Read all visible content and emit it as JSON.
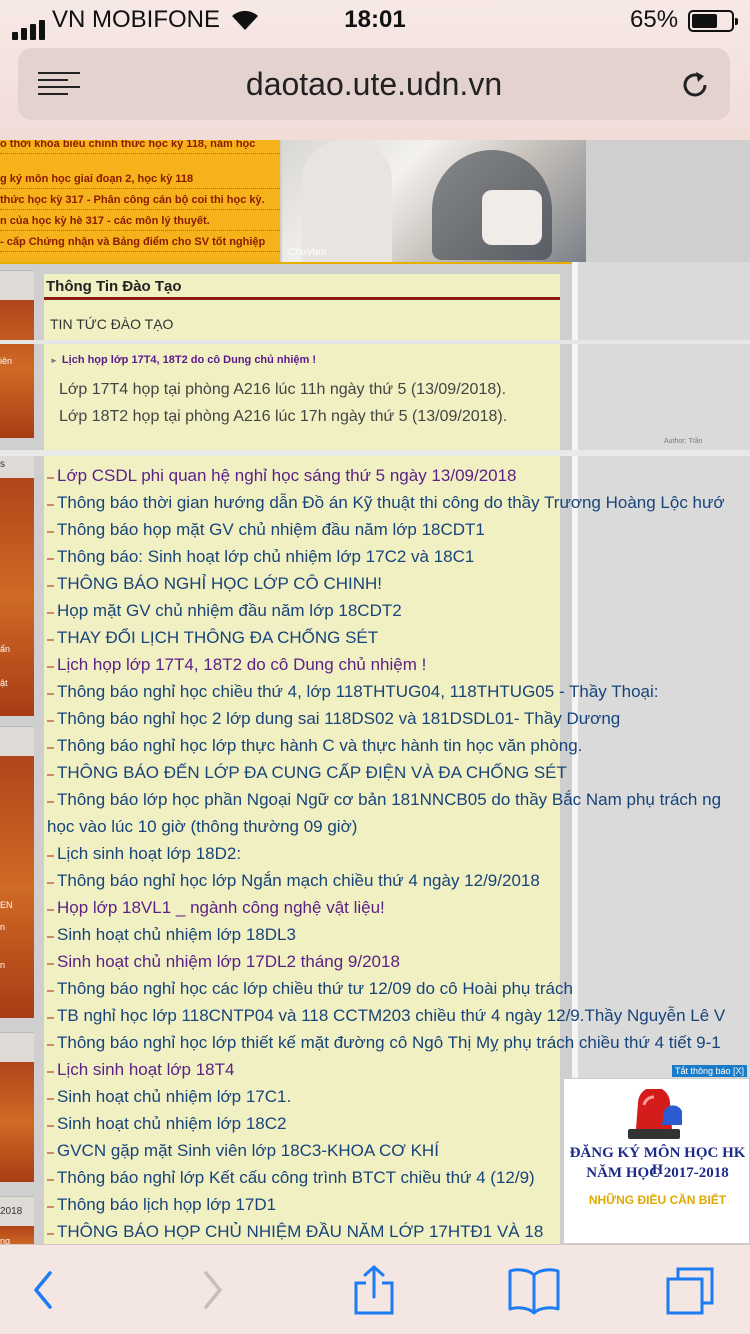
{
  "status_bar": {
    "carrier": "VN MOBIFONE",
    "time": "18:01",
    "battery": "65%",
    "battery_level": 0.65
  },
  "browser": {
    "url": "daotao.ute.udn.vn"
  },
  "banner": {
    "news_lines": [
      "o thời khóa biểu chính thức học kỳ 118, năm học",
      "g ký môn học giai đoạn 2, học kỳ 118",
      "thức học kỳ 317 - Phân công cán bộ coi thi học kỳ.",
      "n của học kỳ hè 317 - các môn lý thuyết.",
      "- cấp Chứng nhận và Bảng điểm cho SV tốt nghiệp"
    ],
    "photo_watermark": "ChoVam"
  },
  "sidebar": {
    "fragments": [
      "iên",
      "s",
      "ẩn",
      "ật",
      "EN",
      "n",
      "n",
      "2018",
      "ng"
    ]
  },
  "section": {
    "title": "Thông Tin Đào Tạo",
    "subtitle": "TIN TỨC ĐÀO TẠO"
  },
  "featured": {
    "link": "Lịch họp lớp 17T4, 18T2 do cô Dung chủ nhiệm !",
    "lines": [
      "Lớp 17T4 họp tại phòng A216 lúc 11h ngày thứ 5 (13/09/2018).",
      "Lớp 18T2 họp tại phòng A216 lúc 17h ngày thứ 5 (13/09/2018)."
    ],
    "author": "Author: Trần"
  },
  "news": [
    {
      "text": "Lớp CSDL phi quan hệ nghỉ học sáng thứ 5 ngày 13/09/2018",
      "visited": true
    },
    {
      "text": "Thông báo thời gian hướng dẫn Đồ án Kỹ thuật thi công do thầy Trương Hoàng Lộc hướ",
      "visited": false
    },
    {
      "text": "Thông báo họp mặt GV chủ nhiệm đầu năm lớp 18CDT1",
      "visited": false
    },
    {
      "text": "Thông báo: Sinh hoạt lớp chủ nhiệm lớp 17C2 và 18C1",
      "visited": false
    },
    {
      "text": "THÔNG BÁO NGHỈ HỌC LỚP CÔ CHINH!",
      "visited": false
    },
    {
      "text": "Họp mặt GV chủ nhiệm đầu năm lớp 18CDT2",
      "visited": false
    },
    {
      "text": "THAY ĐỔI LỊCH THÔNG ĐA CHỐNG SÉT",
      "visited": false
    },
    {
      "text": "Lịch họp lớp 17T4, 18T2 do cô Dung chủ nhiệm !",
      "visited": true
    },
    {
      "text": "Thông báo nghỉ học chiều thứ 4, lớp 118THTUG04, 118THTUG05 - Thầy Thoại:",
      "visited": false
    },
    {
      "text": "Thông báo nghỉ học 2 lớp dung sai 118DS02 và 181DSDL01- Thầy Dương",
      "visited": false
    },
    {
      "text": "Thông báo nghỉ học lớp thực hành C và thực hành tin học văn phòng.",
      "visited": false
    },
    {
      "text": "THÔNG BÁO ĐẾN LỚP ĐA CUNG CẤP ĐIỆN VÀ ĐA CHỐNG SÉT",
      "visited": false
    },
    {
      "text": "Thông báo lớp học phần Ngoại Ngữ cơ bản 181NNCB05 do thầy Bắc Nam phụ trách ng",
      "visited": false
    },
    {
      "text": "học vào lúc 10 giờ (thông thường 09 giờ)",
      "visited": false,
      "continuation": true
    },
    {
      "text": "Lịch sinh hoạt lớp 18D2:",
      "visited": false
    },
    {
      "text": "Thông báo nghỉ học lớp Ngắn mạch chiều thứ 4 ngày 12/9/2018",
      "visited": false
    },
    {
      "text": "Họp lớp 18VL1 _ ngành công nghệ vật liệu!",
      "visited": true
    },
    {
      "text": "Sinh hoạt chủ nhiệm lớp 18DL3",
      "visited": false
    },
    {
      "text": "Sinh hoạt chủ nhiệm lớp 17DL2 tháng 9/2018",
      "visited": true
    },
    {
      "text": "Thông báo nghỉ học các lớp chiều thứ tư 12/09 do cô Hoài phụ trách",
      "visited": false
    },
    {
      "text": "TB nghỉ học lớp 118CNTP04 và 118 CCTM203 chiều thứ 4 ngày 12/9.Thầy Nguyễn Lê V",
      "visited": false
    },
    {
      "text": "Thông báo nghỉ học lớp thiết kế mặt đường cô Ngô Thị Mỵ phụ trách chiều thứ 4 tiết 9-1",
      "visited": false
    },
    {
      "text": "Lịch sinh hoạt lớp 18T4",
      "visited": true
    },
    {
      "text": "Sinh hoạt chủ nhiệm lớp 17C1.",
      "visited": false
    },
    {
      "text": "Sinh hoạt chủ nhiệm lớp 18C2",
      "visited": false
    },
    {
      "text": "GVCN gặp mặt Sinh viên lớp 18C3-KHOA CƠ KHÍ",
      "visited": false
    },
    {
      "text": "Thông báo nghỉ lớp Kết cấu công trình BTCT chiều thứ 4 (12/9)",
      "visited": false
    },
    {
      "text": "Thông báo lịch họp lớp 17D1",
      "visited": false
    },
    {
      "text": "THÔNG BÁO HỌP CHỦ NHIỆM ĐẦU NĂM LỚP 17HTĐ1 VÀ 18",
      "visited": false
    }
  ],
  "popup": {
    "close_label": "Tắt thông báo [X]",
    "line1": "ĐĂNG KÝ MÔN HỌC HK II",
    "line2": "NĂM HỌC 2017-2018",
    "line3": "NHỮNG ĐIỀU CẦN BIẾT"
  },
  "colors": {
    "link": "#17447a",
    "visited": "#5b1f86",
    "content_bg": "#f1f0c3",
    "banner_orange": "#f6b21a",
    "rule_red": "#8b1a10",
    "ios_blue": "#1c7cf4"
  },
  "toolbar_icons": [
    "back-icon",
    "forward-icon",
    "share-icon",
    "bookmarks-icon",
    "tabs-icon"
  ]
}
